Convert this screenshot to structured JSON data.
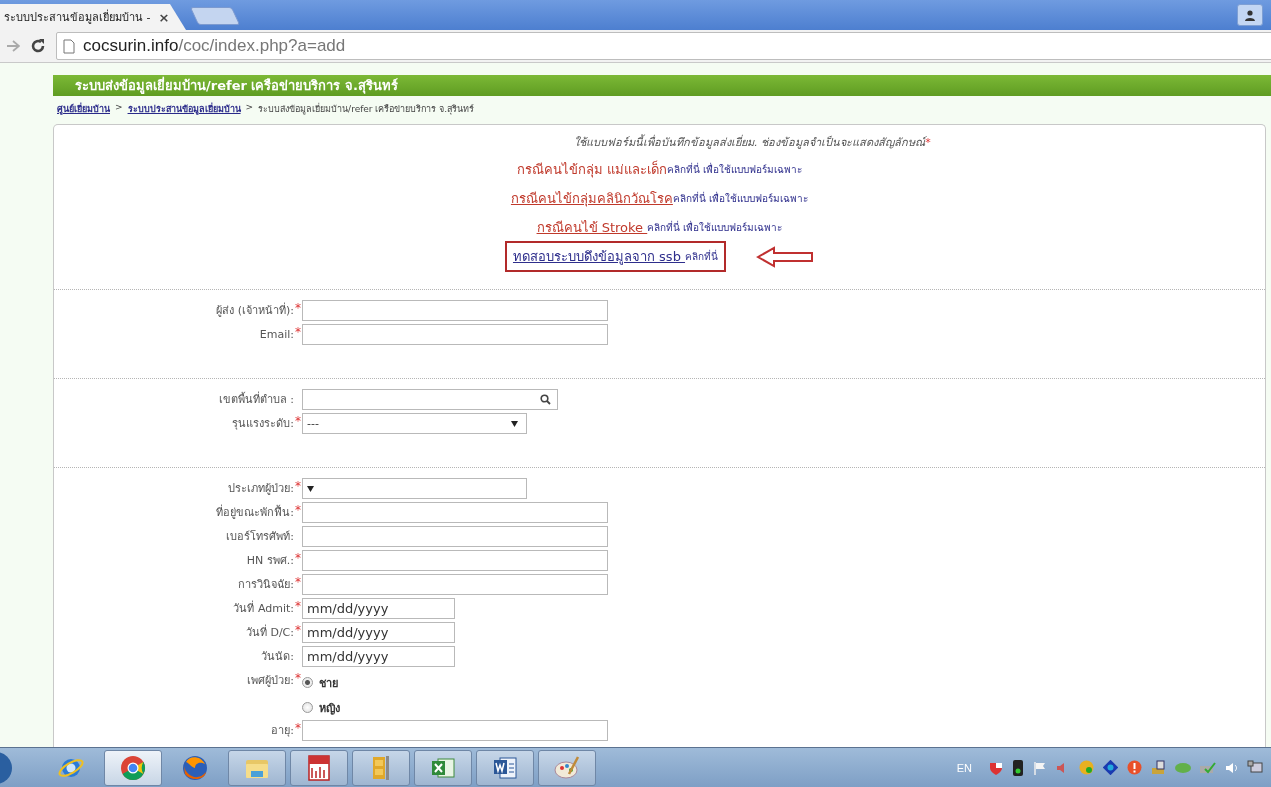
{
  "browser": {
    "tab": {
      "title": "ระบบประสานข้อมูลเยี่ยมบ้าน -",
      "close": "×",
      "selected": true
    },
    "url": {
      "host": "cocsurin.info",
      "path": "/coc/index.php?a=add"
    }
  },
  "page": {
    "header": "ระบบส่งข้อมูลเยี่ยมบ้าน/refer เครือข่ายบริการ จ.สุรินทร์",
    "breadcrumb": [
      {
        "text": "ศูนย์เยี่ยมบ้าน",
        "link": true
      },
      {
        "text": ">",
        "link": false
      },
      {
        "text": "ระบบประสานข้อมูลเยี่ยมบ้าน",
        "link": true
      },
      {
        "text": ">",
        "link": false
      },
      {
        "text": "ระบบส่งข้อมูลเยี่ยมบ้าน/refer เครือข่ายบริการ จ.สุรินทร์",
        "link": false
      }
    ],
    "intro": {
      "text": "ใช้แบบฟอร์มนี้เพื่อบันทึกข้อมูลส่งเยี่ยม. ช่องข้อมูลจำเป็นจะแสดงสัญลักษณ์",
      "required_mark": "*"
    },
    "special_links": [
      {
        "link": "กรณีคนไข้กลุ่ม แม่และเด็ก",
        "underlined": false,
        "color": "#c0392b",
        "suffix": "คลิกที่นี่ เพื่อใช้แบบฟอร์มเฉพาะ",
        "highlighted": false
      },
      {
        "link": "กรณีคนไข้กลุ่มคลินิกวัณโรค",
        "underlined": true,
        "color": "#c0392b",
        "suffix": "คลิกที่นี่ เพื่อใช้แบบฟอร์มเฉพาะ",
        "highlighted": false
      },
      {
        "link": "กรณีคนไข้ Stroke ",
        "underlined": true,
        "color": "#c0392b",
        "suffix": "คลิกที่นี่ เพื่อใช้แบบฟอร์มเฉพาะ",
        "highlighted": false
      },
      {
        "link": "ทดสอบระบบดึงข้อมูลจาก ssb ",
        "underlined": true,
        "color": "#2e2e8c",
        "suffix": "คลิกที่นี่",
        "highlighted": true
      }
    ],
    "sections": [
      {
        "fields": [
          {
            "kind": "text",
            "label": "ผู้ส่ง (เจ้าหน้าที่):",
            "required": true
          },
          {
            "kind": "text",
            "label": "Email:",
            "required": true
          }
        ]
      },
      {
        "fields": [
          {
            "kind": "search",
            "label": "เขตพื้นที่ตำบล :",
            "required": false
          },
          {
            "kind": "select",
            "label": "รุนแรงระดับ:",
            "required": true,
            "value": "---"
          }
        ]
      },
      {
        "fields": [
          {
            "kind": "select",
            "label": "ประเภทผู้ป่วย:",
            "required": true
          },
          {
            "kind": "text",
            "label": "ที่อยู่ขณะพักฟื้น:",
            "required": true
          },
          {
            "kind": "text",
            "label": "เบอร์โทรศัพท์:",
            "required": false
          },
          {
            "kind": "text",
            "label": "HN รพศ.:",
            "required": true
          },
          {
            "kind": "text",
            "label": "การวินิจฉัย:",
            "required": true
          },
          {
            "kind": "date",
            "label": "วันที่ Admit:",
            "required": true,
            "value": "mm/dd/yyyy"
          },
          {
            "kind": "date",
            "label": "วันที่ D/C:",
            "required": true,
            "value": "mm/dd/yyyy"
          },
          {
            "kind": "date",
            "label": "วันนัด:",
            "required": false,
            "value": "mm/dd/yyyy"
          },
          {
            "kind": "radio",
            "label": "เพศผู้ป่วย:",
            "required": true,
            "options": [
              {
                "label": "ชาย",
                "selected": true
              },
              {
                "label": "หญิง",
                "selected": false
              }
            ]
          },
          {
            "kind": "text",
            "label": "อายุ:",
            "required": true
          }
        ]
      }
    ]
  },
  "taskbar": {
    "apps": [
      {
        "kind": "ie",
        "running": false,
        "selected": false
      },
      {
        "kind": "chrome",
        "running": true,
        "selected": true
      },
      {
        "kind": "firefox",
        "running": false,
        "selected": false
      },
      {
        "kind": "explorer",
        "running": true,
        "selected": false
      },
      {
        "kind": "spss",
        "running": true,
        "selected": false
      },
      {
        "kind": "archiver",
        "running": true,
        "selected": false
      },
      {
        "kind": "excel",
        "running": true,
        "selected": false
      },
      {
        "kind": "word",
        "running": true,
        "selected": false
      },
      {
        "kind": "paint",
        "running": true,
        "selected": false
      }
    ],
    "language": "EN"
  }
}
